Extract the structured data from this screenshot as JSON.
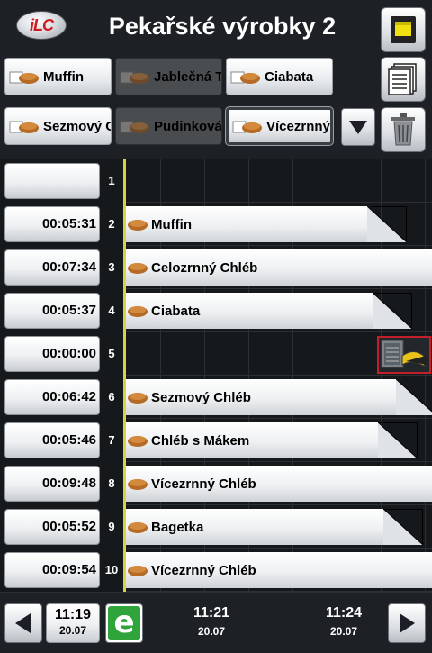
{
  "header": {
    "logo_text": "iLC",
    "title": "Pekařské výrobky 2"
  },
  "programs": [
    {
      "label": "Muffin",
      "state": "light"
    },
    {
      "label": "Jablečná T",
      "state": "dark"
    },
    {
      "label": "Ciabata",
      "state": "light"
    },
    {
      "label": "Sezmový C",
      "state": "light"
    },
    {
      "label": "Pudinková",
      "state": "dark"
    },
    {
      "label": "Vícezrnný",
      "state": "selected"
    }
  ],
  "rows": [
    {
      "num": "1",
      "time": "",
      "product": ""
    },
    {
      "num": "2",
      "time": "00:05:31",
      "product": "Muffin"
    },
    {
      "num": "3",
      "time": "00:07:34",
      "product": "Celozrnný Chléb"
    },
    {
      "num": "4",
      "time": "00:05:37",
      "product": "Ciabata"
    },
    {
      "num": "5",
      "time": "00:00:00",
      "product": ""
    },
    {
      "num": "6",
      "time": "00:06:42",
      "product": "Sezmový Chléb"
    },
    {
      "num": "7",
      "time": "00:05:46",
      "product": "Chléb s Mákem"
    },
    {
      "num": "8",
      "time": "00:09:48",
      "product": "Vícezrnný Chléb"
    },
    {
      "num": "9",
      "time": "00:05:52",
      "product": "Bagetka"
    },
    {
      "num": "10",
      "time": "00:09:54",
      "product": "Vícezrnný Chléb"
    }
  ],
  "footer": {
    "current_time": "11:19",
    "current_date": "20.07",
    "ticks": [
      {
        "time": "11:21",
        "date": "20.07"
      },
      {
        "time": "11:24",
        "date": "20.07"
      }
    ]
  },
  "icons": {
    "logo": "ilc-logo-icon",
    "cooking_path": "cooking-path-icon",
    "list": "list-icon",
    "down": "chevron-down-icon",
    "trash": "trash-icon",
    "bread": "bread-icon",
    "oven": "oven-icon",
    "left": "arrow-left-icon",
    "right": "arrow-right-icon",
    "efficient": "efficient-carelevel-icon"
  },
  "colors": {
    "now_line": "#d8d24a",
    "oven_border": "#c21f2a",
    "efficient_green": "#2ea43a",
    "background": "#1d2126"
  }
}
